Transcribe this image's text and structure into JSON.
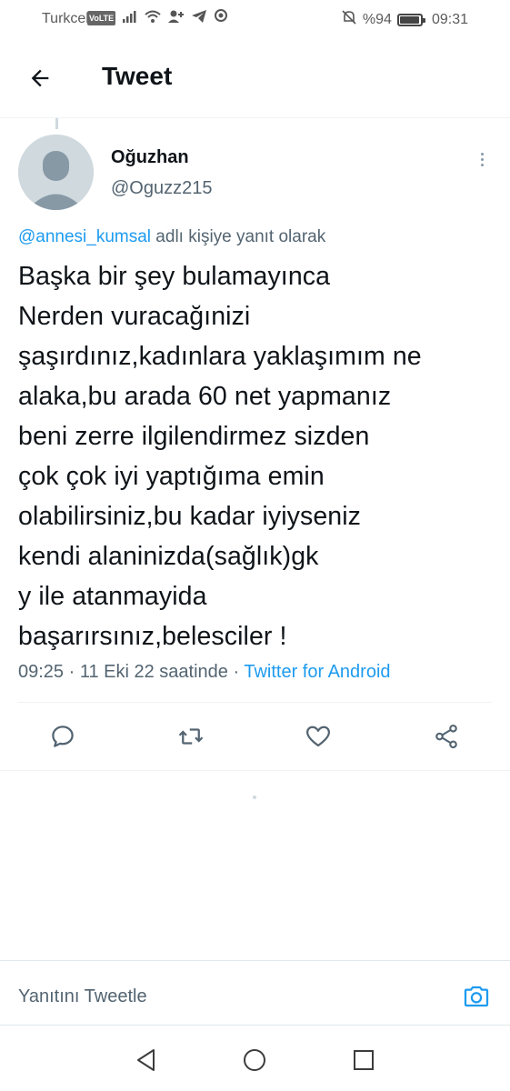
{
  "status_bar": {
    "carrier": "Turkcell",
    "volte": "VoLTE",
    "battery": "%94",
    "battery_level": 0.94,
    "time": "09:31"
  },
  "header": {
    "title": "Tweet",
    "back_icon": "arrow-left-icon"
  },
  "tweet": {
    "author_name": "Oğuzhan",
    "author_handle": "@Oguzz215",
    "reply_mention": "@annesi_kumsal",
    "reply_suffix": " adlı kişiye yanıt olarak",
    "text": "Başka bir şey bulamayınca\nNerden vuracağınizi\nşaşırdınız,kadınlara yaklaşımım ne\nalaka,bu arada 60 net yapmanız\nbeni zerre ilgilendirmez sizden\nçok çok iyi yaptığıma emin\nolabilirsiniz,bu kadar iyiyseniz\nkendi alaninizda(sağlık)gk\ny ile atanmayida\nbaşarırsınız,belesciler !",
    "time": "09:25",
    "separator": " · ",
    "date": "11 Eki 22 saatinde",
    "separator2": " · ",
    "source": "Twitter for Android"
  },
  "actions": {
    "reply_icon": "reply-icon",
    "retweet_icon": "retweet-icon",
    "like_icon": "heart-icon",
    "share_icon": "share-icon"
  },
  "reply_bar": {
    "placeholder": "Yanıtını Tweetle",
    "camera_icon": "camera-icon"
  },
  "nav": {
    "back_icon": "triangle-back-icon",
    "home_icon": "circle-home-icon",
    "recents_icon": "square-recents-icon"
  },
  "colors": {
    "accent": "#1d9bf0",
    "text": "#0f1419",
    "secondary": "#536471"
  }
}
